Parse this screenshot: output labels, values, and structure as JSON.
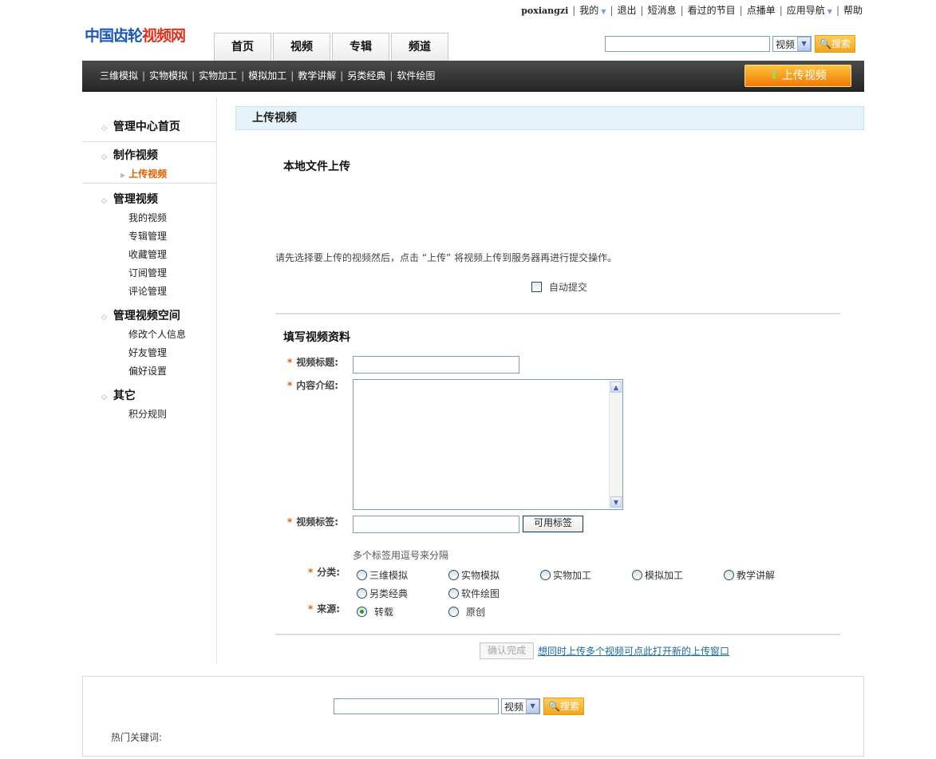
{
  "userbar": {
    "username": "poxiangzi",
    "items": [
      "我的",
      "退出",
      "短消息",
      "看过的节目",
      "点播单",
      "应用导航",
      "帮助"
    ]
  },
  "logo": {
    "part1": "中国齿轮",
    "part2": "视频网"
  },
  "tabs": [
    "首页",
    "视频",
    "专辑",
    "频道"
  ],
  "top_search": {
    "select_value": "视频",
    "button": "搜索"
  },
  "navbar": {
    "links": [
      "三维模拟",
      "实物模拟",
      "实物加工",
      "模拟加工",
      "教学讲解",
      "另类经典",
      "软件绘图"
    ],
    "upload_button": "上传视频"
  },
  "sidebar": {
    "home": "管理中心首页",
    "make": {
      "title": "制作视频",
      "items": [
        "上传视频"
      ]
    },
    "manage": {
      "title": "管理视频",
      "items": [
        "我的视频",
        "专辑管理",
        "收藏管理",
        "订阅管理",
        "评论管理"
      ]
    },
    "space": {
      "title": "管理视频空间",
      "items": [
        "修改个人信息",
        "好友管理",
        "偏好设置"
      ]
    },
    "other": {
      "title": "其它",
      "items": [
        "积分规则"
      ]
    }
  },
  "content": {
    "title": "上传视频",
    "local_upload": "本地文件上传",
    "instruction": "请先选择要上传的视频然后，点击 “上传” 将视频上传到服务器再进行提交操作。",
    "auto_submit": "自动提交",
    "form_heading": "填写视频资料",
    "labels": {
      "title": "视频标题:",
      "intro": "内容介绍:",
      "tags": "视频标签:",
      "category": "分类:",
      "source": "来源:"
    },
    "available_tags_button": "可用标签",
    "tags_hint": "多个标签用逗号来分隔",
    "categories": [
      "三维模拟",
      "实物模拟",
      "实物加工",
      "模拟加工",
      "教学讲解",
      "另类经典",
      "软件绘图"
    ],
    "sources": [
      "转载",
      "原创"
    ],
    "selected_source": "转载",
    "confirm_button": "确认完成",
    "multi_upload_link": "想同时上传多个视频可点此打开新的上传窗口"
  },
  "footer": {
    "select_value": "视频",
    "search_button": "搜索",
    "hot_keywords_label": "热门关键词:"
  }
}
